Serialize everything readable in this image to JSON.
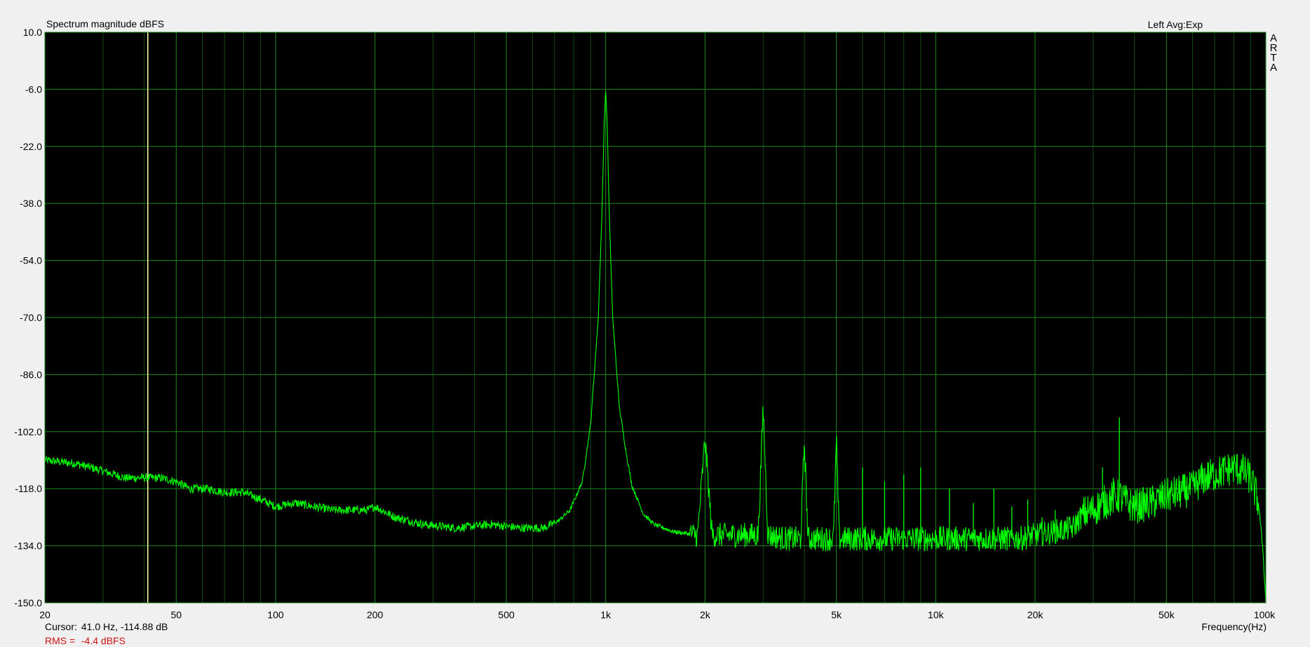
{
  "header": {
    "title": "Spectrum magnitude dBFS",
    "channel": "Left  Avg:Exp",
    "brand_letters": [
      "A",
      "R",
      "T",
      "A"
    ]
  },
  "footer": {
    "cursor_label": "Cursor:",
    "cursor_value": "41.0 Hz, -114.88 dB",
    "rms_label": "RMS =",
    "rms_value": "-4.4 dBFS",
    "xunit": "Frequency(Hz)"
  },
  "colors": {
    "plot_bg": "#000000",
    "grid": "#1e8a1e",
    "trace": "#00ff00",
    "cursor": "#ffffb0",
    "rms_text": "#cc1111",
    "frame": "#1e8a1e"
  },
  "chart_data": {
    "type": "line",
    "title": "Spectrum magnitude dBFS",
    "xlabel": "Frequency(Hz)",
    "ylabel": "",
    "x_scale": "log",
    "xlim": [
      20,
      100000
    ],
    "ylim": [
      -150,
      10
    ],
    "grid": true,
    "x_ticks": [
      20,
      50,
      100,
      200,
      500,
      1000,
      2000,
      5000,
      10000,
      20000,
      50000,
      100000
    ],
    "x_tick_labels": [
      "20",
      "50",
      "100",
      "200",
      "500",
      "1k",
      "2k",
      "5k",
      "10k",
      "20k",
      "50k",
      "100k"
    ],
    "y_ticks": [
      10,
      -6,
      -22,
      -38,
      -54,
      -70,
      -86,
      -102,
      -118,
      -134,
      -150
    ],
    "y_tick_labels": [
      "10.0",
      "-6.0",
      "-22.0",
      "-38.0",
      "-54.0",
      "-70.0",
      "-86.0",
      "-102.0",
      "-118.0",
      "-134.0",
      "-150.0"
    ],
    "cursor": {
      "x": 41.0,
      "y": -114.88
    },
    "series": [
      {
        "x": [
          20,
          25,
          30,
          35,
          41,
          45,
          50,
          55,
          62,
          70,
          80,
          90,
          100,
          115,
          130,
          150,
          170,
          190,
          200,
          230,
          280,
          350,
          450,
          550,
          650,
          720,
          780,
          850,
          900,
          950,
          975,
          990,
          1000,
          1010,
          1025,
          1050,
          1100,
          1150,
          1200,
          1300,
          1400,
          1600,
          1900,
          2000,
          2100,
          2500,
          2900,
          3000,
          3100,
          3500,
          3900,
          4000,
          4100,
          4500,
          4900,
          5000,
          5100,
          6000,
          7000,
          8000,
          9000,
          10000,
          12000,
          15000,
          18000,
          20000,
          23000,
          26000,
          28000,
          30000,
          32000,
          34000,
          36000,
          38000,
          40000,
          45000,
          50000,
          55000,
          60000,
          65000,
          70000,
          75000,
          80000,
          85000,
          90000,
          95000,
          98000,
          100000
        ],
        "y": [
          -110,
          -111,
          -113,
          -115,
          -114.88,
          -115,
          -116,
          -118,
          -118,
          -119,
          -119,
          -121,
          -123,
          -122,
          -123,
          -124,
          -124,
          -124,
          -123,
          -126,
          -128,
          -129,
          -128,
          -129,
          -129,
          -127,
          -124,
          -116,
          -100,
          -70,
          -40,
          -15,
          -6,
          -15,
          -40,
          -70,
          -95,
          -107,
          -117,
          -125,
          -128,
          -130,
          -131,
          -104,
          -131,
          -131,
          -131,
          -95,
          -131,
          -132,
          -132,
          -104,
          -132,
          -132,
          -132,
          -104,
          -132,
          -132,
          -132,
          -132,
          -132,
          -132,
          -132,
          -132,
          -132,
          -131,
          -130,
          -129,
          -125,
          -124,
          -122,
          -121,
          -120,
          -122,
          -123,
          -122,
          -120,
          -119,
          -118,
          -115,
          -114,
          -113,
          -112,
          -113,
          -115,
          -122,
          -135,
          -150
        ]
      }
    ]
  }
}
